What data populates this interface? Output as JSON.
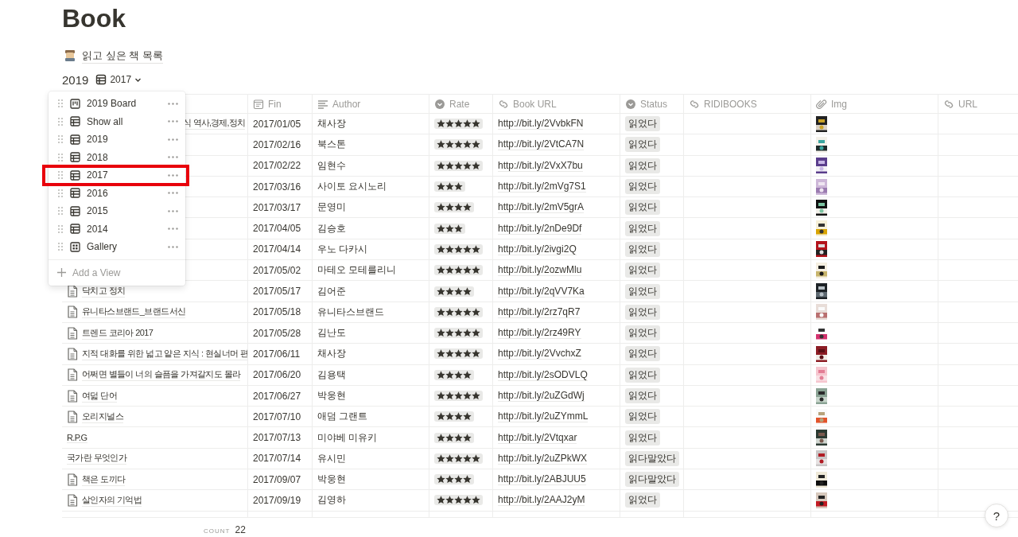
{
  "page_title": "Book",
  "link": {
    "label": "읽고 싶은 책 목록"
  },
  "database": {
    "title": "2019",
    "view": {
      "label": "2017",
      "kind": "table"
    }
  },
  "columns": [
    {
      "label": "Fin",
      "kind": "date"
    },
    {
      "label": "Author",
      "kind": "text"
    },
    {
      "label": "Rate",
      "kind": "select"
    },
    {
      "label": "Book URL",
      "kind": "link"
    },
    {
      "label": "Status",
      "kind": "select"
    },
    {
      "label": "RIDIBOOKS",
      "kind": "link"
    },
    {
      "label": "Img",
      "kind": "file"
    },
    {
      "label": "URL",
      "kind": "link"
    }
  ],
  "rows": [
    {
      "name_tail": "식 역사,경제,정치",
      "fin": "2017/01/05",
      "author": "채사장",
      "stars": 5,
      "url": "http://bit.ly/2VvbkFN",
      "status": "읽었다"
    },
    {
      "fin": "2017/02/16",
      "author": "북스톤",
      "stars": 5,
      "url": "http://bit.ly/2VtCA7N",
      "status": "읽었다"
    },
    {
      "fin": "2017/02/22",
      "author": "임현수",
      "stars": 5,
      "url": "http://bit.ly/2VxX7bu",
      "status": "읽었다"
    },
    {
      "fin": "2017/03/16",
      "author": "사이토 요시노리",
      "stars": 3,
      "url": "http://bit.ly/2mVg7S1",
      "status": "읽었다"
    },
    {
      "fin": "2017/03/17",
      "author": "문영미",
      "stars": 4,
      "url": "http://bit.ly/2mV5grA",
      "status": "읽었다"
    },
    {
      "fin": "2017/04/05",
      "author": "김승호",
      "stars": 3,
      "url": "http://bit.ly/2nDe9Df",
      "status": "읽었다"
    },
    {
      "fin": "2017/04/14",
      "author": "우노 다카시",
      "stars": 5,
      "url": "http://bit.ly/2ivgi2Q",
      "status": "읽었다"
    },
    {
      "fin": "2017/05/02",
      "author": "마테오 모테를리니",
      "stars": 5,
      "url": "http://bit.ly/2ozwMlu",
      "status": "읽었다"
    },
    {
      "name": "닥치고 정치",
      "page_icon": true,
      "fin": "2017/05/17",
      "author": "김어준",
      "stars": 4,
      "url": "http://bit.ly/2qVV7Ka",
      "status": "읽었다"
    },
    {
      "name": "유니타스브랜드_브랜드서신",
      "page_icon": true,
      "fin": "2017/05/18",
      "author": "유니타스브랜드",
      "stars": 5,
      "url": "http://bit.ly/2rz7qR7",
      "status": "읽었다"
    },
    {
      "name": "트렌드 코리아 2017",
      "page_icon": true,
      "fin": "2017/05/28",
      "author": "김난도",
      "stars": 5,
      "url": "http://bit.ly/2rz49RY",
      "status": "읽었다"
    },
    {
      "name": "지적 대화를 위한 넓고 얕은 지식 : 현실너머 편",
      "page_icon": true,
      "fin": "2017/06/11",
      "author": "채사장",
      "stars": 5,
      "url": "http://bit.ly/2VvchxZ",
      "status": "읽었다"
    },
    {
      "name": "어쩌면 별들이 너의 슬픔을 가져갈지도 몰라",
      "page_icon": true,
      "fin": "2017/06/20",
      "author": "김용택",
      "stars": 4,
      "url": "http://bit.ly/2sODVLQ",
      "status": "읽었다"
    },
    {
      "name": "여덟 단어",
      "page_icon": true,
      "fin": "2017/06/27",
      "author": "박웅현",
      "stars": 5,
      "url": "http://bit.ly/2uZGdWj",
      "status": "읽었다"
    },
    {
      "name": "오리지널스",
      "page_icon": true,
      "fin": "2017/07/10",
      "author": "애덤 그랜트",
      "stars": 4,
      "url": "http://bit.ly/2uZYmmL",
      "status": "읽었다"
    },
    {
      "name": "R.P.G",
      "page_icon": false,
      "fin": "2017/07/13",
      "author": "미야베 미유키",
      "stars": 4,
      "url": "http://bit.ly/2Vtqxar",
      "status": "읽었다"
    },
    {
      "name": "국가란 무엇인가",
      "page_icon": false,
      "fin": "2017/07/14",
      "author": "유시민",
      "stars": 5,
      "url": "http://bit.ly/2uZPkWX",
      "status": "읽다말았다"
    },
    {
      "name": "책은 도끼다",
      "page_icon": true,
      "fin": "2017/09/07",
      "author": "박웅현",
      "stars": 4,
      "url": "http://bit.ly/2ABJUU5",
      "status": "읽다말았다"
    },
    {
      "name": "살인자의 기억법",
      "page_icon": true,
      "fin": "2017/09/19",
      "author": "김영하",
      "stars": 5,
      "url": "http://bit.ly/2AAJ2yM",
      "status": "읽었다"
    }
  ],
  "footer": {
    "label": "COUNT",
    "value": "22"
  },
  "view_menu": {
    "items": [
      {
        "label": "2019 Board",
        "kind": "board",
        "selected": false
      },
      {
        "label": "Show all",
        "kind": "table",
        "selected": false
      },
      {
        "label": "2019",
        "kind": "table",
        "selected": false
      },
      {
        "label": "2018",
        "kind": "table",
        "selected": false
      },
      {
        "label": "2017",
        "kind": "table",
        "selected": true
      },
      {
        "label": "2016",
        "kind": "table",
        "selected": false
      },
      {
        "label": "2015",
        "kind": "table",
        "selected": false
      },
      {
        "label": "2014",
        "kind": "table",
        "selected": false
      },
      {
        "label": "Gallery",
        "kind": "gallery",
        "selected": false
      }
    ],
    "add_label": "Add a View"
  },
  "help": {
    "label": "?"
  }
}
